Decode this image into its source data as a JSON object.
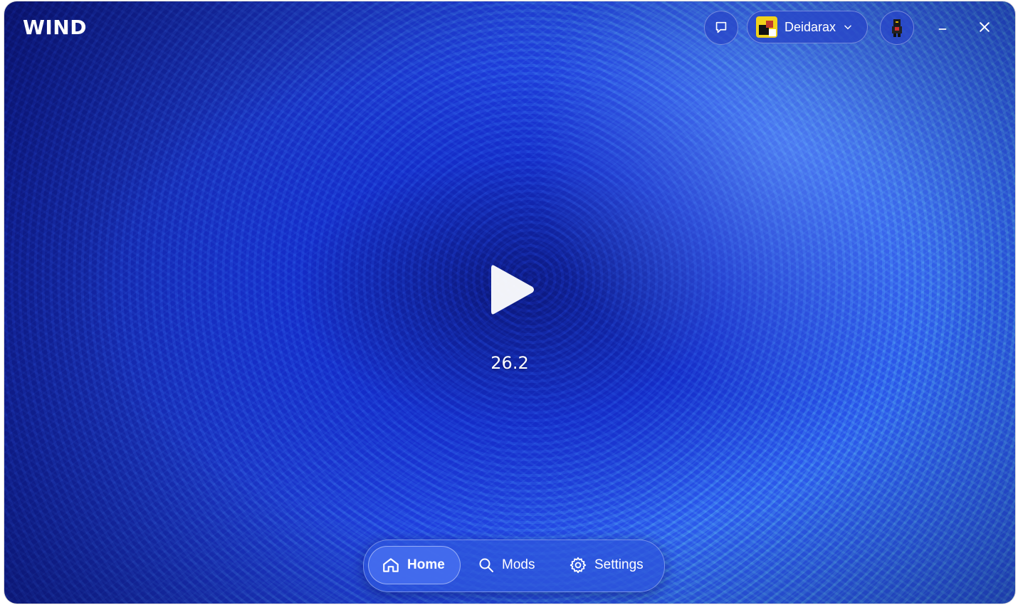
{
  "app": {
    "logo_text": "WIND"
  },
  "header": {
    "account_name": "Deidarax",
    "feedback_icon": "chat-bubble-icon",
    "avatar_icon": "player-avatar-icon",
    "minimize_icon": "minimize-icon",
    "close_icon": "close-icon"
  },
  "main": {
    "play_icon": "play-icon",
    "version": "26.2"
  },
  "nav": {
    "items": [
      {
        "label": "Home",
        "icon": "home-icon",
        "active": true
      },
      {
        "label": "Mods",
        "icon": "search-icon",
        "active": false
      },
      {
        "label": "Settings",
        "icon": "gear-icon",
        "active": false
      }
    ]
  },
  "colors": {
    "accent": "#2c58e6",
    "text": "#ffffff"
  }
}
